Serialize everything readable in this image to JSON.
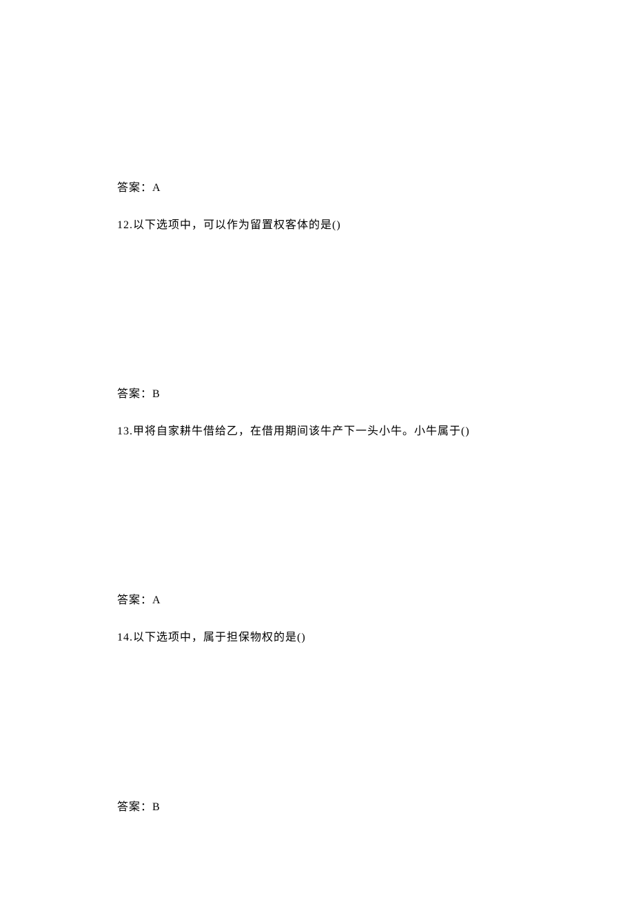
{
  "blocks": [
    {
      "type": "answer",
      "text": "答案：A"
    },
    {
      "type": "question",
      "text": "12.以下选项中，可以作为留置权客体的是()"
    },
    {
      "type": "answer",
      "text": "答案：B"
    },
    {
      "type": "question",
      "text": "13.甲将自家耕牛借给乙，在借用期间该牛产下一头小牛。小牛属于()"
    },
    {
      "type": "answer",
      "text": "答案：A"
    },
    {
      "type": "question",
      "text": "14.以下选项中，属于担保物权的是()"
    },
    {
      "type": "answer",
      "text": "答案：B"
    }
  ]
}
